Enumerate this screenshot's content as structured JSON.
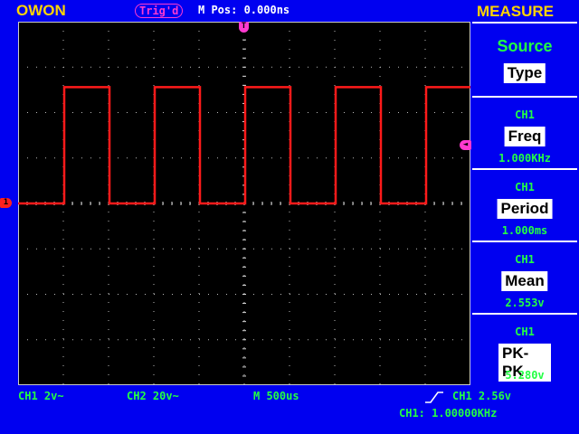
{
  "topbar": {
    "brand": "OWON",
    "trigger_status": "Trig'd",
    "m_pos": "M Pos: 0.000ns",
    "menu_title": "MEASURE"
  },
  "markers": {
    "trigger_pos": "T",
    "trigger_level": "◄",
    "ch1_ground": "1"
  },
  "sidebar": {
    "source_title": "Source",
    "type_label": "Type",
    "items": [
      {
        "channel": "CH1",
        "label": "Freq",
        "value": "1.000KHz"
      },
      {
        "channel": "CH1",
        "label": "Period",
        "value": "1.000ms"
      },
      {
        "channel": "CH1",
        "label": "Mean",
        "value": "2.553v"
      },
      {
        "channel": "CH1",
        "label": "PK-PK",
        "value": "5.280v"
      }
    ]
  },
  "statusbar": {
    "ch1_scale": "CH1 2v~",
    "ch2_scale": "CH2 20v~",
    "timebase": "M 500us",
    "trigger": "CH1 2.56v",
    "frequency": "CH1: 1.00000KHz"
  },
  "colors": {
    "background": "#0000f0",
    "trace": "#ff1a1a",
    "text_green": "#22ff44",
    "text_yellow": "#ffd400",
    "trigger_magenta": "#ff3ad0"
  },
  "waveform": {
    "type": "square",
    "channel": "CH1",
    "frequency_khz": 1.0,
    "period_ms": 1.0,
    "low_div": 0,
    "high_div": 2.56,
    "duty": 0.5
  }
}
